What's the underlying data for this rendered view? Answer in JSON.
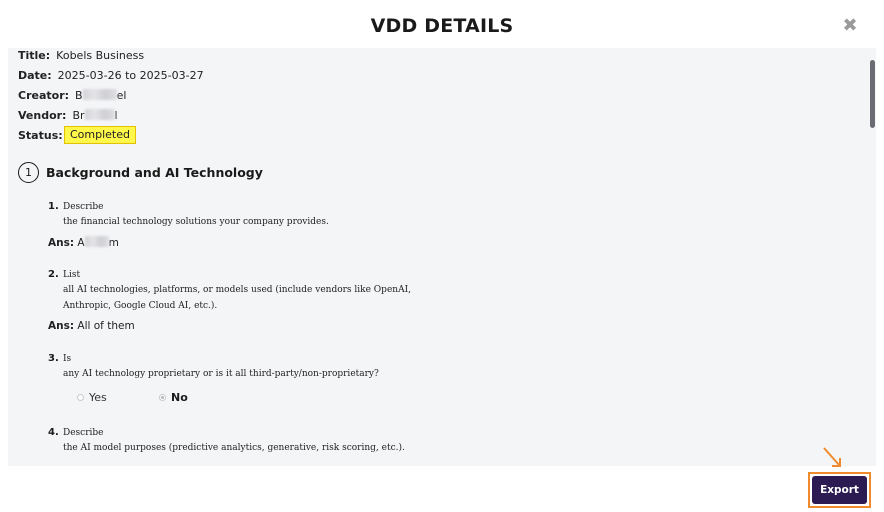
{
  "modal": {
    "title": "VDD DETAILS",
    "close_glyph": "✖",
    "close_icon": "close-icon"
  },
  "details": {
    "title_label": "Title:",
    "title_value": "Kobels Business",
    "date_label": "Date:",
    "date_value": "2025-03-26 to 2025-03-27",
    "creator_label": "Creator:",
    "creator_prefix": "B",
    "creator_suffix": "el",
    "vendor_label": "Vendor:",
    "vendor_prefix": "Br",
    "vendor_suffix": "l",
    "status_label": "Status:",
    "status_value": "Completed",
    "status_color": "#fff84a"
  },
  "section": {
    "number": "1",
    "title": "Background and AI Technology"
  },
  "questions": [
    {
      "number": "1.",
      "verb": "Describe",
      "lines": [
        "the financial technology solutions your company provides."
      ],
      "answer_label": "Ans:",
      "answer_prefix": "A",
      "answer_suffix": "m"
    },
    {
      "number": "2.",
      "verb": "List",
      "lines": [
        "all AI technologies, platforms, or models used (include vendors like OpenAI,",
        "Anthropic, Google Cloud AI, etc.)."
      ],
      "answer_label": "Ans:",
      "answer_value": "All of them"
    },
    {
      "number": "3.",
      "verb": "Is",
      "lines": [
        "any AI technology proprietary or is it all third-party/non-proprietary?"
      ],
      "options": [
        {
          "label": "Yes",
          "selected": false
        },
        {
          "label": "No",
          "selected": true
        }
      ]
    },
    {
      "number": "4.",
      "verb": "Describe",
      "lines": [
        "the AI model purposes (predictive analytics, generative, risk scoring, etc.)."
      ]
    }
  ],
  "footer": {
    "export_label": "Export",
    "accent_color": "#2c1b52",
    "highlight_color": "#f08b2d"
  }
}
